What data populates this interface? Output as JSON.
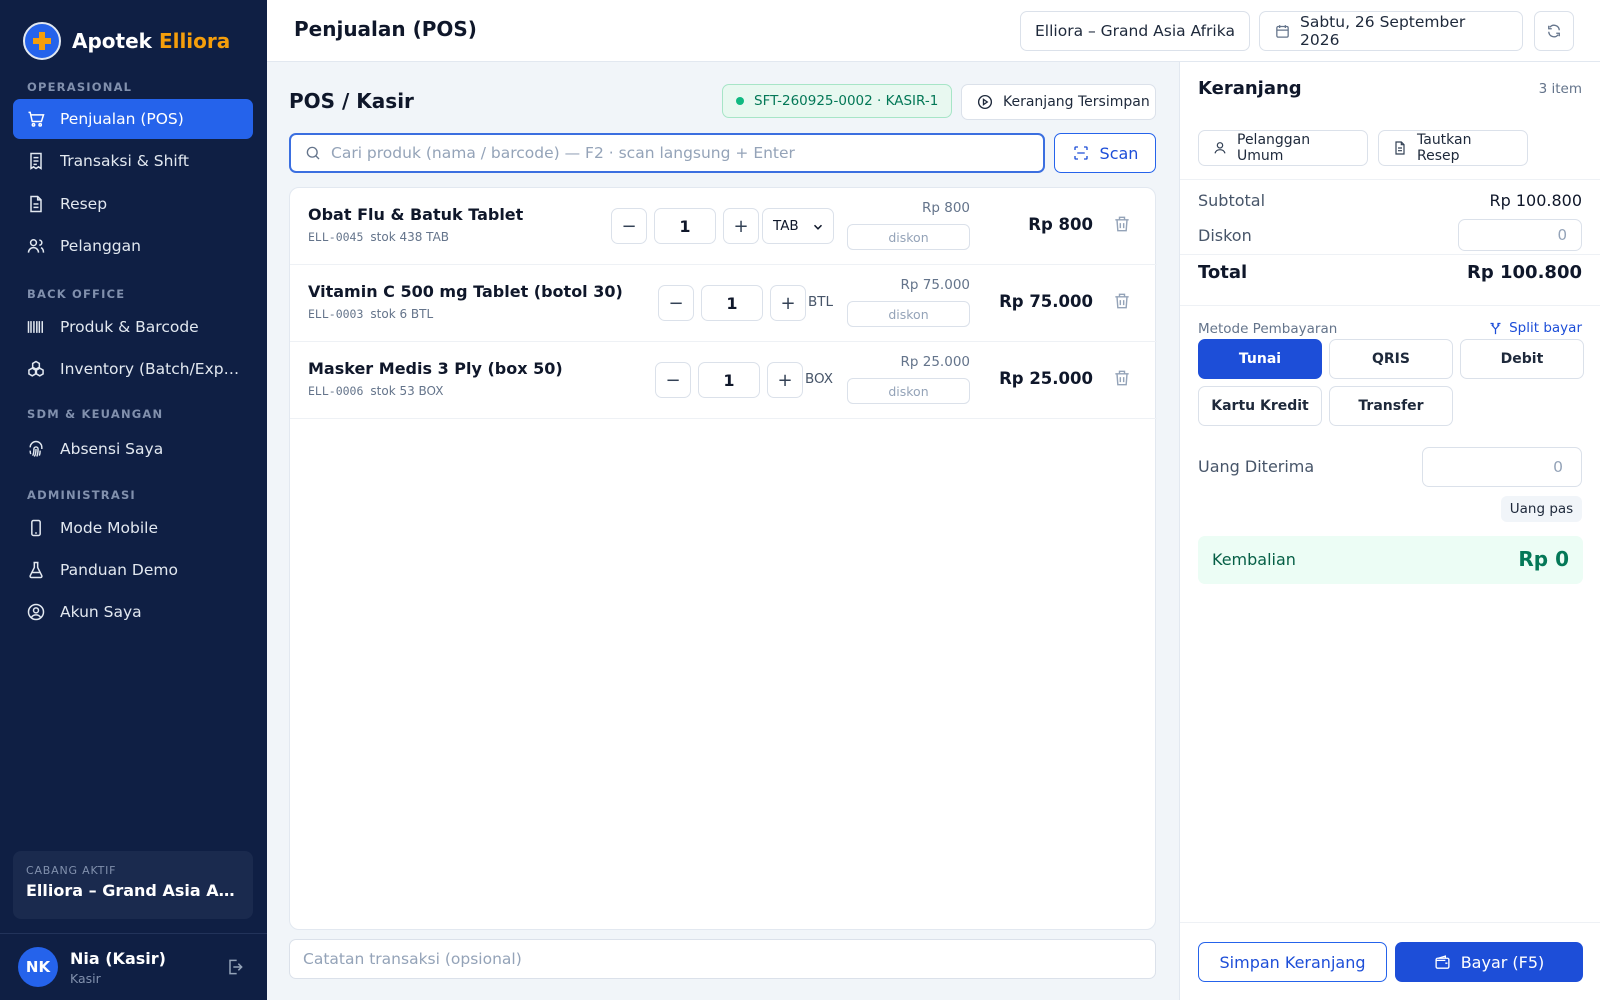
{
  "brand": {
    "name": "Apotek",
    "accent": "Elliora",
    "accent_color": "#f59e0b",
    "primary_color": "#2563eb"
  },
  "sidebar": {
    "sections": [
      {
        "label": "OPERASIONAL",
        "items": [
          {
            "label": "Penjualan (POS)",
            "icon": "cart-icon",
            "active": true
          },
          {
            "label": "Transaksi & Shift",
            "icon": "receipt-icon"
          },
          {
            "label": "Resep",
            "icon": "document-icon"
          },
          {
            "label": "Pelanggan",
            "icon": "users-icon"
          }
        ]
      },
      {
        "label": "BACK OFFICE",
        "items": [
          {
            "label": "Produk & Barcode",
            "icon": "barcode-icon"
          },
          {
            "label": "Inventory (Batch/Expiry)",
            "icon": "boxes-icon"
          }
        ]
      },
      {
        "label": "SDM & KEUANGAN",
        "items": [
          {
            "label": "Absensi Saya",
            "icon": "fingerprint-icon"
          }
        ]
      },
      {
        "label": "ADMINISTRASI",
        "items": [
          {
            "label": "Mode Mobile",
            "icon": "smartphone-icon"
          },
          {
            "label": "Panduan Demo",
            "icon": "flask-icon"
          },
          {
            "label": "Akun Saya",
            "icon": "user-circle-icon"
          }
        ]
      }
    ],
    "branch": {
      "caption": "CABANG AKTIF",
      "name": "Elliora – Grand Asia Afrika"
    },
    "user": {
      "initials": "NK",
      "name": "Nia (Kasir)",
      "role": "Kasir"
    }
  },
  "topbar": {
    "title": "Penjualan (POS)",
    "branch": "Elliora – Grand Asia Afrika",
    "date": "Sabtu, 26 September 2026"
  },
  "pos": {
    "title": "POS / Kasir",
    "shift": "SFT-260925-0002 · KASIR-1",
    "saved_carts_label": "Keranjang Tersimpan",
    "search_placeholder": "Cari produk (nama / barcode) — F2 · scan langsung + Enter",
    "scan_label": "Scan",
    "discount_placeholder": "diskon",
    "note_placeholder": "Catatan transaksi (opsional)",
    "items": [
      {
        "name": "Obat Flu & Batuk Tablet",
        "code": "ELL-0045",
        "stock": "stok 438 TAB",
        "qty": "1",
        "unit": "TAB",
        "unit_is_select": true,
        "unit_price": "Rp 800",
        "line_total": "Rp 800"
      },
      {
        "name": "Vitamin C 500 mg Tablet (botol 30)",
        "code": "ELL-0003",
        "stock": "stok 6 BTL",
        "qty": "1",
        "unit": "BTL",
        "unit_is_select": false,
        "unit_price": "Rp 75.000",
        "line_total": "Rp 75.000"
      },
      {
        "name": "Masker Medis 3 Ply (box 50)",
        "code": "ELL-0006",
        "stock": "stok 53 BOX",
        "qty": "1",
        "unit": "BOX",
        "unit_is_select": false,
        "unit_price": "Rp 25.000",
        "line_total": "Rp 25.000"
      }
    ]
  },
  "cart": {
    "title": "Keranjang",
    "count": "3 item",
    "customer_label": "Pelanggan Umum",
    "prescription_label": "Tautkan Resep",
    "subtotal_label": "Subtotal",
    "subtotal": "Rp 100.800",
    "discount_label": "Diskon",
    "discount_value": "0",
    "total_label": "Total",
    "total": "Rp 100.800",
    "payment_label": "Metode Pembayaran",
    "split_label": "Split bayar",
    "methods": [
      "Tunai",
      "QRIS",
      "Debit",
      "Kartu Kredit",
      "Transfer"
    ],
    "active_method": "Tunai",
    "received_label": "Uang Diterima",
    "received_value": "0",
    "exact_label": "Uang pas",
    "change_label": "Kembalian",
    "change": "Rp 0",
    "save_label": "Simpan Keranjang",
    "pay_label": "Bayar (F5)"
  }
}
